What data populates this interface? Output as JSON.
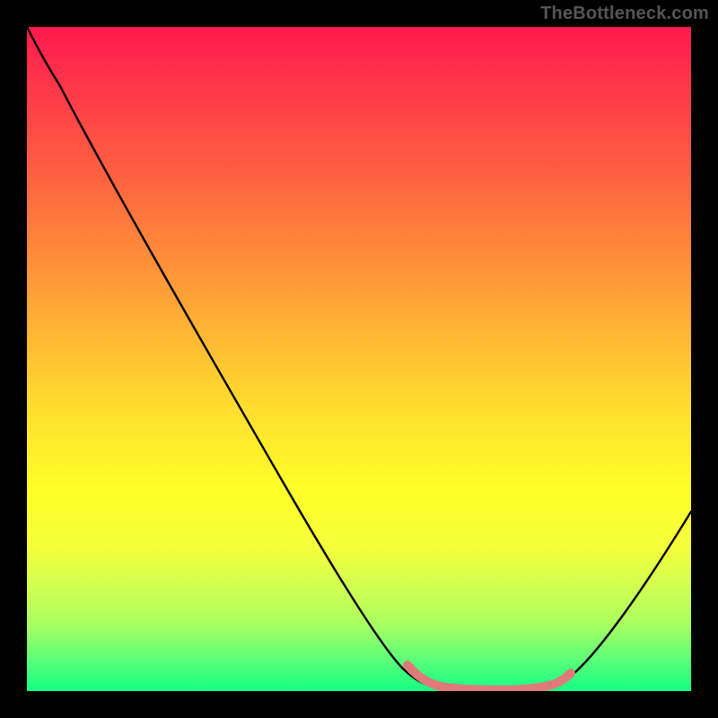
{
  "watermark": "TheBottleneck.com",
  "colors": {
    "curve_stroke": "#000000",
    "highlight_stroke": "#e07a7a",
    "background": "#000000"
  },
  "chart_data": {
    "type": "line",
    "title": "",
    "xlabel": "",
    "ylabel": "",
    "xlim": [
      0,
      100
    ],
    "ylim": [
      0,
      100
    ],
    "series": [
      {
        "name": "bottleneck-curve",
        "x": [
          0,
          5,
          10,
          15,
          20,
          25,
          30,
          35,
          40,
          45,
          50,
          55,
          58,
          60,
          62,
          65,
          68,
          72,
          76,
          79,
          82,
          86,
          90,
          95,
          100
        ],
        "values": [
          100,
          93,
          85,
          77,
          69,
          61,
          53,
          45,
          37,
          29,
          21,
          13,
          8,
          5,
          3,
          1.5,
          0.8,
          0.5,
          0.5,
          0.8,
          2,
          5,
          10,
          18,
          28
        ]
      },
      {
        "name": "optimal-range-highlight",
        "x": [
          58,
          62,
          65,
          68,
          72,
          76,
          79,
          81
        ],
        "values": [
          4.2,
          2.5,
          1.5,
          0.9,
          0.6,
          0.6,
          0.9,
          1.8
        ]
      }
    ],
    "gradient_stops": [
      {
        "pos": 0,
        "color": "#ff1a4d"
      },
      {
        "pos": 10,
        "color": "#ff3a4a"
      },
      {
        "pos": 22,
        "color": "#ff6040"
      },
      {
        "pos": 34,
        "color": "#ff8a3a"
      },
      {
        "pos": 46,
        "color": "#ffb634"
      },
      {
        "pos": 58,
        "color": "#ffdf2e"
      },
      {
        "pos": 70,
        "color": "#ffff28"
      },
      {
        "pos": 78,
        "color": "#f5ff3a"
      },
      {
        "pos": 84,
        "color": "#d4ff50"
      },
      {
        "pos": 90,
        "color": "#a8ff60"
      },
      {
        "pos": 95,
        "color": "#60ff78"
      },
      {
        "pos": 100,
        "color": "#14ff84"
      }
    ]
  }
}
